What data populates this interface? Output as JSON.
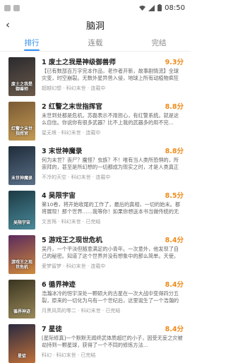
{
  "status": {
    "time": "08:50"
  },
  "header": {
    "title": "脑洞"
  },
  "tabs": [
    "排行",
    "连载",
    "完结"
  ],
  "books": [
    {
      "title": "1 废土之我是神级御兽师",
      "score": "9.3分",
      "desc": "【已有数部百万字完本作品，老作者开新，故事剧情流】全球灾变，时空崩裂。无数外星异兽入侵，地球上所有动植物疯狂变异...",
      "meta": "超越幻想 · 科幻末世 · 连载中",
      "cover_text": "废土之我是御兽师",
      "colors": [
        "#2b2a2e",
        "#6b5a4a"
      ]
    },
    {
      "title": "2 红警之末世指挥官",
      "score": "8.8分",
      "desc": "末世到处都是危机，苏磊表示不用担心，有红警系统。就是这么自信。你说你有很多武器？比不上我的武器多的用不完...",
      "meta": "星无垠 · 科幻末世 · 连载中",
      "cover_text": "红警之末世指挥官",
      "colors": [
        "#7a5a34",
        "#c49a54"
      ]
    },
    {
      "title": "3 末世神魔录",
      "score": "8.8分",
      "desc": "何为末世？丧尸？魔怪？虫族？不！唯有当人类所恐惧的，所崇拜的，甚至是所幻想的一切都成为现实之时，才是人类真正的末世...",
      "meta": "不冷的天空 · 科幻末世 · 连载中",
      "cover_text": "末世神魔录",
      "colors": [
        "#1f2c3a",
        "#5a7088"
      ]
    },
    {
      "title": "4 吴限宇宙",
      "score": "8.5分",
      "desc": "第10卷，将开始收尾的工作了，最后的真相，一切的始末。都将展现！那个世界……我等你！如果你想送本书当做传统的无限流，那么...",
      "meta": "文言殇 · 科幻末世 · 已完结",
      "cover_text": "吴限宇宙",
      "colors": [
        "#1d3a44",
        "#4a8a9a"
      ]
    },
    {
      "title": "5 游戏王之现世危机",
      "score": "8.4分",
      "desc": "吴丹，一个平淡但随意满足的小青年。一次意外，他发现了自己的秘密。知道了这个世界并没有想象中的那么简单。天使，恶魔，...",
      "meta": "爱梦留梦 · 科幻末世 · 连载中",
      "cover_text": "游戏王之现世危机",
      "colors": [
        "#5a2a5e",
        "#d08a3a"
      ]
    },
    {
      "title": "6 循界神迹",
      "score": "8.4分",
      "desc": "浩瀚冰冷的恒宇深处一颗硕大的古星在一次大战中变得四分五裂，原来的一切化为乌有一个世纪后，这里诞生了一个浩瀚的世界，...",
      "meta": "月黑风高的零二 · 科幻末世 · 已完结",
      "cover_text": "循界神迹",
      "colors": [
        "#3a3420",
        "#9a8a5a"
      ]
    },
    {
      "title": "7 星徒",
      "score": "8.4分",
      "desc": "[星际修真]一个默默无闻终武体质超烂的小子，因受无妄之灾被劫持到一颗星球，获得了一个不同的修炼方法...",
      "meta": "科幻 · 科幻末世 · 已完结",
      "cover_text": "星徒",
      "colors": [
        "#2a2a40",
        "#c0703a"
      ]
    }
  ]
}
